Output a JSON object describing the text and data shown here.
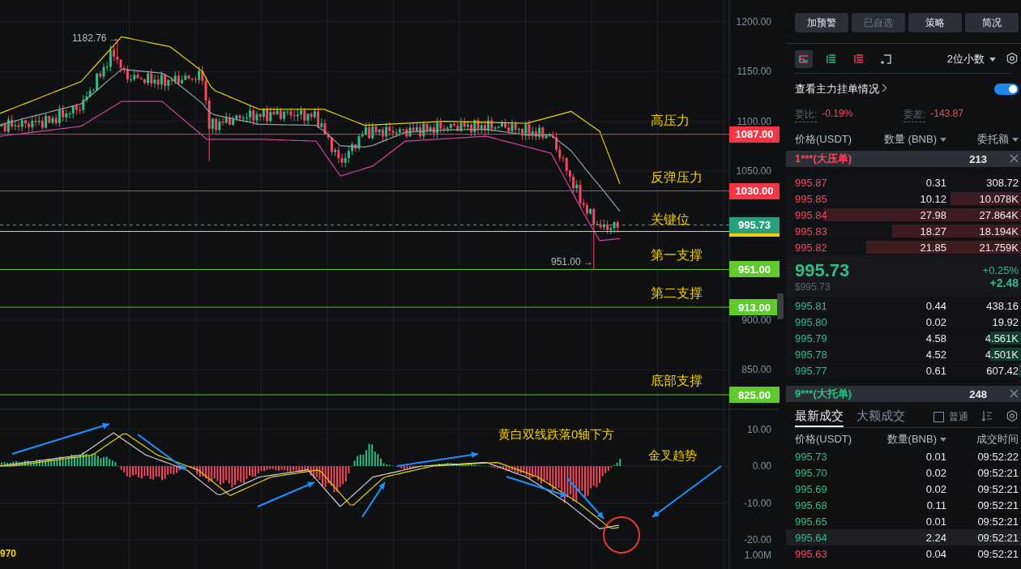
{
  "chart": {
    "price_ticks": [
      "1200.00",
      "1150.00",
      "1100.00",
      "1050.00",
      "900.00",
      "850.00"
    ],
    "high_marker": "1182.76 →",
    "low_marker": "951.00 →",
    "levels": [
      {
        "price": "1087.00",
        "color": "#f23645",
        "note": "高压力"
      },
      {
        "price": "1030.00",
        "color": "#f23645",
        "note": "反弹压力"
      },
      {
        "price": "951.00",
        "color": "#5fc92e",
        "note": "第一支撑"
      },
      {
        "price": "913.00",
        "color": "#5fc92e",
        "note": "第二支撑"
      },
      {
        "price": "825.00",
        "color": "#5fc92e",
        "note": "底部支撑"
      }
    ],
    "current_price": {
      "price": "995.73",
      "note": "关键位"
    },
    "macd_ticks": [
      "10.00",
      "0.00",
      "-10.00",
      "-20.00"
    ],
    "macd_notes": [
      "黄白双线跌落0轴下方",
      "金叉趋势"
    ],
    "volume_tick": "1.00M",
    "indicator_value": "970"
  },
  "panel": {
    "buttons": [
      {
        "label": "加预警",
        "disabled": false
      },
      {
        "label": "已自选",
        "disabled": true
      },
      {
        "label": "策略",
        "disabled": false
      },
      {
        "label": "简况",
        "disabled": false
      }
    ],
    "view_modes": [
      {
        "kind": "both",
        "selected": true
      },
      {
        "kind": "bids",
        "selected": false
      },
      {
        "kind": "asks",
        "selected": false
      },
      {
        "kind": "add",
        "selected": false
      }
    ],
    "precision": "2位小数",
    "main_orders": {
      "label": "查看主力挂单情况",
      "on": true
    },
    "ratio": {
      "label": "委比:",
      "value": "-0.19%"
    },
    "diff": {
      "label": "委差:",
      "value": "-143.87"
    },
    "book_columns": [
      {
        "label": "价格(USDT)",
        "dropdown": false
      },
      {
        "label": "数量 (BNB)",
        "dropdown": true
      },
      {
        "label": "委托额",
        "dropdown": true
      }
    ],
    "ask_alert": {
      "label": "1***(大压单)",
      "amount": "213"
    },
    "asks": [
      {
        "price": "995.87",
        "qty": "0.31",
        "total": "308.72"
      },
      {
        "price": "995.85",
        "qty": "10.12",
        "total": "10.078K",
        "level": 0.3
      },
      {
        "price": "995.84",
        "qty": "27.98",
        "total": "27.864K",
        "level": 0.84
      },
      {
        "price": "995.83",
        "qty": "18.27",
        "total": "18.194K",
        "level": 0.55
      },
      {
        "price": "995.82",
        "qty": "21.85",
        "total": "21.759K",
        "level": 0.66
      }
    ],
    "last": {
      "price": "995.73",
      "usd": "$995.73",
      "change_pct": "+0.25%",
      "change": "+2.48"
    },
    "bids": [
      {
        "price": "995.81",
        "qty": "0.44",
        "total": "438.16"
      },
      {
        "price": "995.80",
        "qty": "0.02",
        "total": "19.92"
      },
      {
        "price": "995.79",
        "qty": "4.58",
        "total": "4.561K",
        "level": 0.13
      },
      {
        "price": "995.78",
        "qty": "4.52",
        "total": "4.501K",
        "level": 0.13
      },
      {
        "price": "995.77",
        "qty": "0.61",
        "total": "607.42",
        "level": 0.01
      }
    ],
    "bid_alert": {
      "label": "9***(大托单)",
      "amount": "248"
    },
    "trade_tabs": [
      {
        "label": "最新成交",
        "selected": true
      },
      {
        "label": "大额成交",
        "selected": false
      }
    ],
    "normal_filter": {
      "label": "普通",
      "checked": false
    },
    "trade_columns": [
      {
        "label": "价格(USDT)",
        "dropdown": false
      },
      {
        "label": "数量(BNB)",
        "dropdown": true
      },
      {
        "label": "成交时间",
        "dropdown": false
      }
    ],
    "trades": [
      {
        "price": "995.73",
        "qty": "0.01",
        "time": "09:52:22",
        "buy": true,
        "highlighted": false
      },
      {
        "price": "995.70",
        "qty": "0.02",
        "time": "09:52:21",
        "buy": true,
        "highlighted": false
      },
      {
        "price": "995.69",
        "qty": "0.02",
        "time": "09:52:21",
        "buy": true,
        "highlighted": false
      },
      {
        "price": "995.68",
        "qty": "0.11",
        "time": "09:52:21",
        "buy": true,
        "highlighted": false
      },
      {
        "price": "995.65",
        "qty": "0.01",
        "time": "09:52:21",
        "buy": true,
        "highlighted": false
      },
      {
        "price": "995.64",
        "qty": "2.24",
        "time": "09:52:21",
        "buy": true,
        "highlighted": true
      },
      {
        "price": "995.63",
        "qty": "0.04",
        "time": "09:52:21",
        "buy": false,
        "highlighted": false
      }
    ]
  }
}
